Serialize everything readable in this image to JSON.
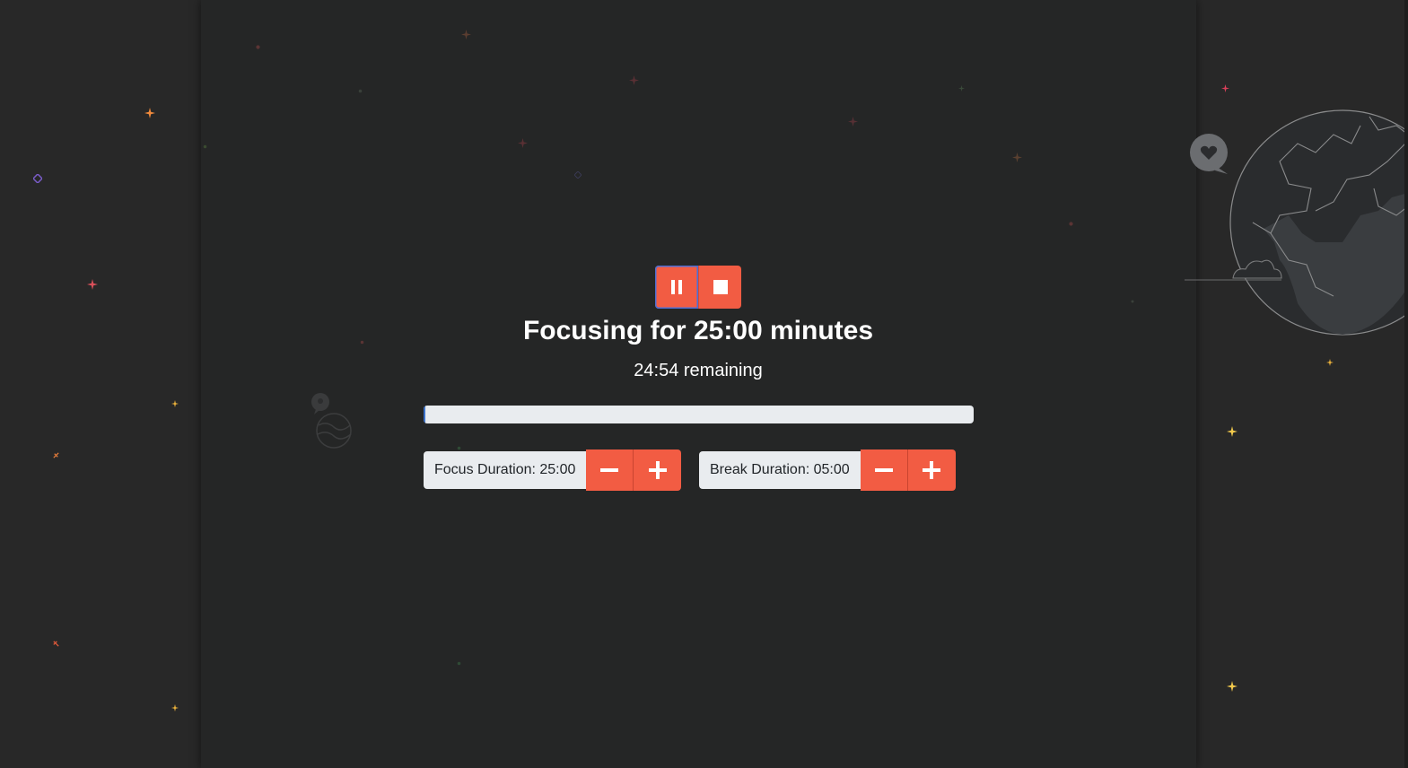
{
  "timer": {
    "title": "Focusing for 25:00 minutes",
    "remaining": "24:54 remaining",
    "progress": 0.004
  },
  "controls": {
    "pause_icon": "pause-icon",
    "stop_icon": "stop-icon"
  },
  "focus": {
    "label": "Focus Duration: 25:00"
  },
  "break": {
    "label": "Break Duration: 05:00"
  },
  "colors": {
    "background": "#282828",
    "panel": "#252626",
    "accent": "#f25c43",
    "text": "#ffffff",
    "label_bg": "#e9ecef"
  }
}
